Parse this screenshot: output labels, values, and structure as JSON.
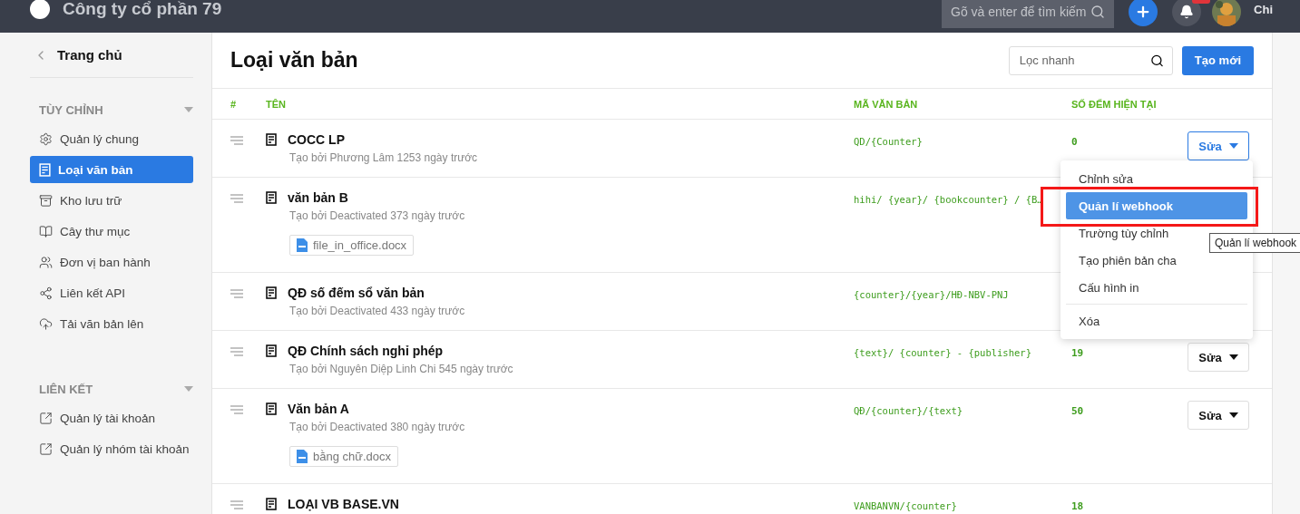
{
  "header": {
    "company": "Công ty cổ phần 79",
    "search": {
      "placeholder": "Gõ và enter để tìm kiếm"
    },
    "user": "Chi"
  },
  "sidebar": {
    "back": "Trang chủ",
    "sections": [
      {
        "title": "TÙY CHỈNH",
        "items": [
          {
            "label": "Quản lý chung",
            "selected": false
          },
          {
            "label": "Loại văn bản",
            "selected": true
          },
          {
            "label": "Kho lưu trữ",
            "selected": false
          },
          {
            "label": "Cây thư mục",
            "selected": false
          },
          {
            "label": "Đơn vị ban hành",
            "selected": false
          },
          {
            "label": "Liên kết API",
            "selected": false
          },
          {
            "label": "Tải văn bản lên",
            "selected": false
          }
        ]
      },
      {
        "title": "LIÊN KẾT",
        "items": [
          {
            "label": "Quản lý tài khoản",
            "selected": false
          },
          {
            "label": "Quản lý nhóm tài khoản",
            "selected": false
          }
        ]
      }
    ]
  },
  "page": {
    "title": "Loại văn bản",
    "filter": {
      "placeholder": "Lọc nhanh"
    },
    "create_button": "Tạo mới"
  },
  "table": {
    "columns": [
      "#",
      "TÊN",
      "MÃ VĂN BẢN",
      "SỐ ĐẾM HIỆN TẠI"
    ],
    "rows": [
      {
        "title": "COCC LP",
        "meta": "Tạo bởi Phương Lâm 1253 ngày trước",
        "code": "QD/{Counter}",
        "count": "0",
        "action": {
          "label": "Sửa",
          "open": true
        }
      },
      {
        "title": "văn bản B",
        "meta": "Tạo bởi Deactivated 373 ngày trước",
        "attachment": "file_in_office.docx",
        "code": "hihi/ {year}/ {bookcounter} / {B…"
      },
      {
        "title": "QĐ số đếm sổ văn bản",
        "meta": "Tạo bởi Deactivated 433 ngày trước",
        "code": "{counter}/{year}/HĐ-NBV-PNJ"
      },
      {
        "title": "QĐ Chính sách nghỉ phép",
        "meta": "Tạo bởi Nguyên Diệp Linh Chi 545 ngày trước",
        "code": "{text}/ {counter} - {publisher}",
        "count": "19",
        "action": {
          "label": "Sửa",
          "open": false
        }
      },
      {
        "title": "Văn bản A",
        "meta": "Tạo bởi Deactivated 380 ngày trước",
        "attachment": "bằng chữ.docx",
        "code": "QĐ/{counter}/{text}",
        "count": "50",
        "action": {
          "label": "Sửa",
          "open": false
        }
      },
      {
        "title": "LOẠI VB BASE.VN",
        "code": "VANBANVN/{counter}",
        "count": "18"
      }
    ]
  },
  "menu": {
    "items": [
      {
        "label": "Chỉnh sửa",
        "selected": false
      },
      {
        "label": "Quản lí webhook",
        "selected": true
      },
      {
        "label": "Trường tùy chỉnh",
        "selected": false
      },
      {
        "label": "Tạo phiên bản cha",
        "selected": false
      },
      {
        "label": "Cấu hình in",
        "selected": false
      },
      {
        "label": "Xóa",
        "selected": false,
        "kind": "danger"
      }
    ],
    "tooltip": "Quản lí webhook"
  }
}
